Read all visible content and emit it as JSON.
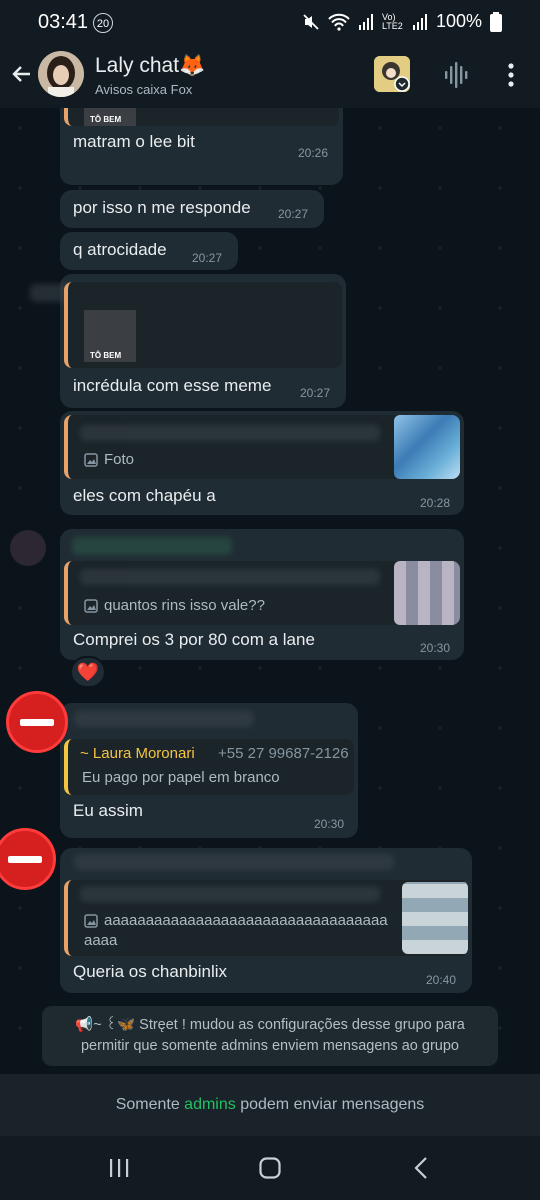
{
  "status": {
    "time": "03:41",
    "notif_count": "20",
    "volte": "Vo)\nLTE2",
    "battery": "100%"
  },
  "header": {
    "title": "Laly chat🦊",
    "subtitle": "Avisos caixa Fox"
  },
  "messages": [
    {
      "text": "matram o lee bit",
      "time": "20:26",
      "sticker_label": "TÔ BEM"
    },
    {
      "text": "por isso n me responde",
      "time": "20:27"
    },
    {
      "text": "q atrocidade",
      "time": "20:27"
    },
    {
      "text": "incrédula com esse meme",
      "time": "20:27",
      "sticker_label": "TÔ BEM"
    },
    {
      "text": "eles com chapéu a",
      "time": "20:28",
      "quote_sub": "Foto"
    },
    {
      "text": "Comprei os 3 por 80 com a lane",
      "time": "20:30",
      "quote_sub": "quantos rins isso vale??",
      "reaction": "❤️"
    },
    {
      "text": "Eu assim",
      "time": "20:30",
      "quote_author": "~ Laura Moronari",
      "quote_phone": "+55 27 99687-2126",
      "quote_sub": "Eu pago por papel em branco"
    },
    {
      "text": "Queria os chanbinlix",
      "time": "20:40",
      "quote_sub_line1": "aaaaaaaaaaaaaaaaaaaaaaaaaaaaaaaaaa",
      "quote_sub_line2": "aaaa"
    }
  ],
  "system_message": {
    "line1": "📢~ ꒰🦋 Stręet ! mudou as configurações desse grupo para",
    "line2": "permitir que somente admins enviem mensagens ao grupo"
  },
  "footer": {
    "prefix": "Somente ",
    "link": "admins",
    "suffix": " podem enviar mensagens"
  },
  "colors": {
    "bg": "#0b141a",
    "bubble": "#202c33",
    "accent": "#21c063"
  }
}
